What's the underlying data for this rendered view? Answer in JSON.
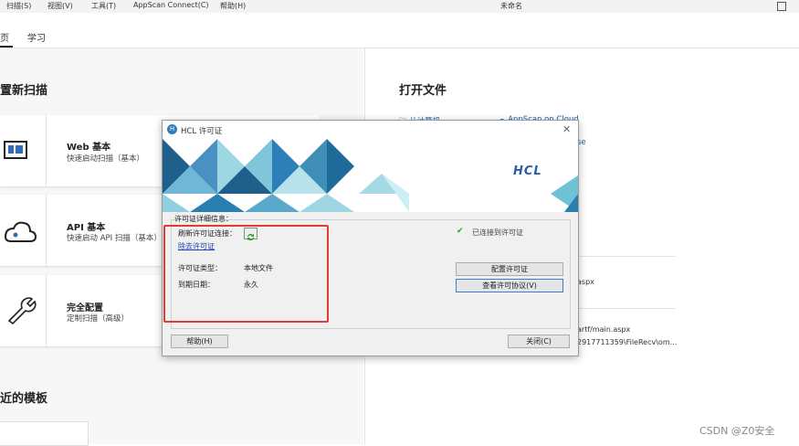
{
  "menubar": {
    "items": [
      "扫描(S)",
      "视图(V)",
      "工具(T)",
      "AppScan Connect(C)",
      "帮助(H)"
    ],
    "window_title": "未命名"
  },
  "tabs": [
    "页",
    "学习"
  ],
  "left": {
    "new_scan_heading": "置新扫描",
    "cards": [
      {
        "title": "Web 基本",
        "subtitle": "快速启动扫描（基本）"
      },
      {
        "title": "API 基本",
        "subtitle": "快速启动 API 扫描（基本）"
      },
      {
        "title": "完全配置",
        "subtitle": "定制扫描（高级）"
      }
    ],
    "templates_heading": "近的模板"
  },
  "right": {
    "open_file_heading": "打开文件",
    "from_computer": "从计算机",
    "appscan_cloud": "AppScan on Cloud",
    "cloud_suffix": "se",
    "recent1": "aspx",
    "recent2_line1": "artf/main.aspx",
    "recent2_line2": "2917711359\\FileRecv\\om..."
  },
  "dialog": {
    "title": "HCL 许可证",
    "brand": "HCL",
    "group_label": "许可证详细信息：",
    "refresh_label": "刷新许可证连接：",
    "remove_link": "除去许可证",
    "type_label": "许可证类型：",
    "type_value": "本地文件",
    "expiry_label": "到期日期：",
    "expiry_value": "永久",
    "connected_status": "已连接到许可证",
    "configure_button": "配置许可证",
    "view_agreement_button": "查看许可协议(V)",
    "help_button": "帮助(H)",
    "close_button": "关闭(C)"
  },
  "watermark": "CSDN @Z0安全"
}
